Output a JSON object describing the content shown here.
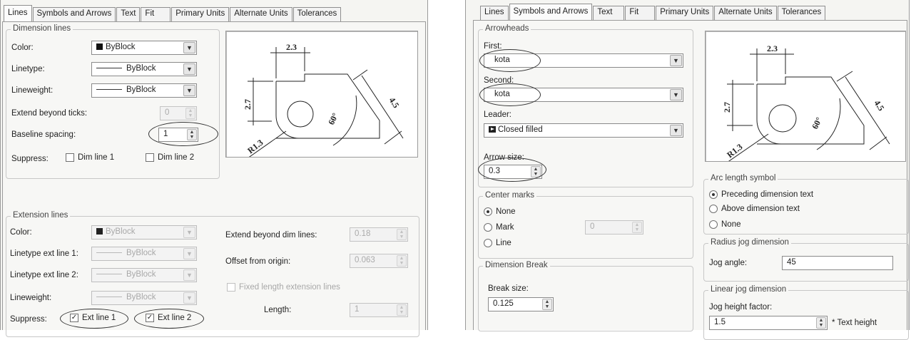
{
  "left_panel": {
    "tabs": [
      "Lines",
      "Symbols and Arrows",
      "Text",
      "Fit",
      "Primary Units",
      "Alternate Units",
      "Tolerances"
    ],
    "active_tab": "Lines",
    "dimension_lines": {
      "legend": "Dimension lines",
      "color_label": "Color:",
      "color_value": "ByBlock",
      "linetype_label": "Linetype:",
      "linetype_value": "ByBlock",
      "lineweight_label": "Lineweight:",
      "lineweight_value": "ByBlock",
      "extend_ticks_label": "Extend beyond ticks:",
      "extend_ticks_value": "0",
      "baseline_label": "Baseline spacing:",
      "baseline_value": "1",
      "suppress_label": "Suppress:",
      "dim_line_1": "Dim line 1",
      "dim_line_2": "Dim line 2"
    },
    "extension_lines": {
      "legend": "Extension lines",
      "color_label": "Color:",
      "color_value": "ByBlock",
      "linetype1_label": "Linetype ext line 1:",
      "linetype1_value": "ByBlock",
      "linetype2_label": "Linetype ext line 2:",
      "linetype2_value": "ByBlock",
      "lineweight_label": "Lineweight:",
      "lineweight_value": "ByBlock",
      "suppress_label": "Suppress:",
      "ext_line_1": "Ext line 1",
      "ext_line_2": "Ext line 2",
      "extend_dim_label": "Extend beyond dim lines:",
      "extend_dim_value": "0.18",
      "offset_label": "Offset from origin:",
      "offset_value": "0.063",
      "fixed_length_label": "Fixed length extension lines",
      "length_label": "Length:",
      "length_value": "1"
    },
    "preview": {
      "dim_h": "2.3",
      "dim_v": "2.7",
      "dim_diag": "4.5",
      "angle": "60°",
      "radius": "R1.3"
    }
  },
  "right_panel": {
    "tabs": [
      "Lines",
      "Symbols and Arrows",
      "Text",
      "Fit",
      "Primary Units",
      "Alternate Units",
      "Tolerances"
    ],
    "active_tab": "Symbols and Arrows",
    "arrowheads": {
      "legend": "Arrowheads",
      "first_label": "First:",
      "first_value": "kota",
      "second_label": "Second:",
      "second_value": "kota",
      "leader_label": "Leader:",
      "leader_value": "Closed filled",
      "arrow_size_label": "Arrow size:",
      "arrow_size_value": "0.3"
    },
    "center_marks": {
      "legend": "Center marks",
      "none": "None",
      "mark": "Mark",
      "line": "Line",
      "value": "0"
    },
    "dimension_break": {
      "legend": "Dimension Break",
      "break_size_label": "Break size:",
      "break_size_value": "0.125"
    },
    "arc_length": {
      "legend": "Arc length symbol",
      "preceding": "Preceding dimension text",
      "above": "Above dimension text",
      "none": "None"
    },
    "radius_jog": {
      "legend": "Radius jog dimension",
      "jog_angle_label": "Jog angle:",
      "jog_angle_value": "45"
    },
    "linear_jog": {
      "legend": "Linear jog dimension",
      "jog_height_label": "Jog height factor:",
      "jog_height_value": "1.5",
      "text_height": "* Text height"
    },
    "preview": {
      "dim_h": "2.3",
      "dim_v": "2.7",
      "dim_diag": "4.5",
      "angle": "60°",
      "radius": "R1.3"
    }
  }
}
